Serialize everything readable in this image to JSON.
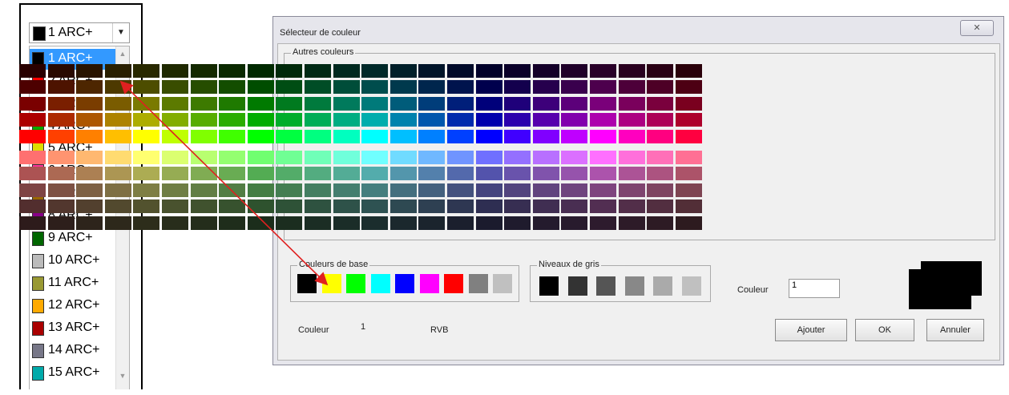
{
  "combo": {
    "value": "1 ARC+",
    "swatch": "#000000"
  },
  "list_items": [
    {
      "label": "1 ARC+",
      "color": "#000000",
      "selected": true
    },
    {
      "label": "2 ARC+",
      "color": "#ff0000"
    },
    {
      "label": "3 ARC+",
      "color": "#003399"
    },
    {
      "label": "4 ARC+",
      "color": "#00aa00"
    },
    {
      "label": "5 ARC+",
      "color": "#dddd00"
    },
    {
      "label": "6 ARC+",
      "color": "#ff3399"
    },
    {
      "label": "7 ARC+",
      "color": "#996600"
    },
    {
      "label": "8 ARC+",
      "color": "#880088"
    },
    {
      "label": "9 ARC+",
      "color": "#006600"
    },
    {
      "label": "10 ARC+",
      "color": "#bbbbbb"
    },
    {
      "label": "11 ARC+",
      "color": "#999933"
    },
    {
      "label": "12 ARC+",
      "color": "#ffaa00"
    },
    {
      "label": "13 ARC+",
      "color": "#aa0000"
    },
    {
      "label": "14 ARC+",
      "color": "#777788"
    },
    {
      "label": "15 ARC+",
      "color": "#00aaaa"
    }
  ],
  "dialog": {
    "title": "Sélecteur de couleur",
    "close_icon": "close-icon",
    "other_colors_label": "Autres couleurs",
    "base_colors_label": "Couleurs de base",
    "gray_levels_label": "Niveaux de gris",
    "color_field_label": "Couleur",
    "color_field_value": "1",
    "bottom_color_label": "Couleur",
    "bottom_color_value": "1",
    "rgb_label": "RVB",
    "add_button": "Ajouter",
    "ok_button": "OK",
    "cancel_button": "Annuler",
    "base_colors": [
      "#000000",
      "#ffff00",
      "#00ff00",
      "#00ffff",
      "#0000ff",
      "#ff00ff",
      "#ff0000",
      "#808080",
      "#c0c0c0"
    ],
    "gray_levels": [
      "#000000",
      "#333333",
      "#555555",
      "#888888",
      "#aaaaaa",
      "#c0c0c0"
    ],
    "preview_color": "#000000"
  }
}
